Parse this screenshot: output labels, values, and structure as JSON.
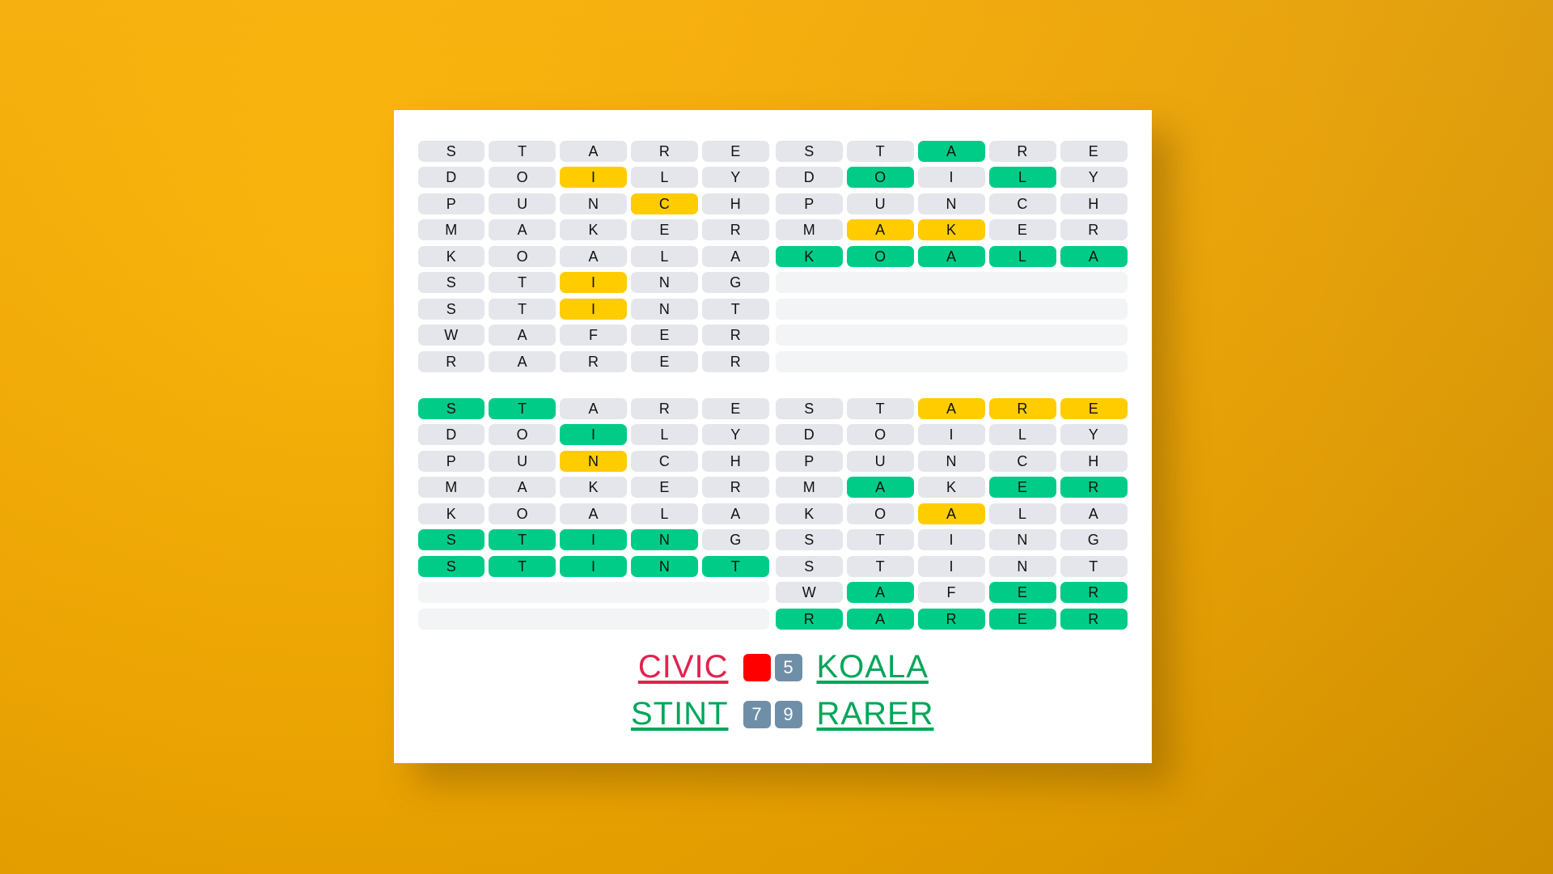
{
  "theme": {
    "background": "#f2a900",
    "card_bg": "#ffffff",
    "tile_empty": "#e4e6eb",
    "tile_blank": "#f3f4f6",
    "tile_green": "#00cc88",
    "tile_yellow": "#ffcc00",
    "word_red": "#e0234e",
    "word_green": "#00a65a",
    "badge_blue": "#6f8fa8",
    "badge_red": "#ff0000"
  },
  "grids": [
    {
      "id": "grid-top-left",
      "rows": [
        {
          "letters": [
            "S",
            "T",
            "A",
            "R",
            "E"
          ],
          "states": [
            "n",
            "n",
            "n",
            "n",
            "n"
          ]
        },
        {
          "letters": [
            "D",
            "O",
            "I",
            "L",
            "Y"
          ],
          "states": [
            "n",
            "n",
            "y",
            "n",
            "n"
          ]
        },
        {
          "letters": [
            "P",
            "U",
            "N",
            "C",
            "H"
          ],
          "states": [
            "n",
            "n",
            "n",
            "y",
            "n"
          ]
        },
        {
          "letters": [
            "M",
            "A",
            "K",
            "E",
            "R"
          ],
          "states": [
            "n",
            "n",
            "n",
            "n",
            "n"
          ]
        },
        {
          "letters": [
            "K",
            "O",
            "A",
            "L",
            "A"
          ],
          "states": [
            "n",
            "n",
            "n",
            "n",
            "n"
          ]
        },
        {
          "letters": [
            "S",
            "T",
            "I",
            "N",
            "G"
          ],
          "states": [
            "n",
            "n",
            "y",
            "n",
            "n"
          ]
        },
        {
          "letters": [
            "S",
            "T",
            "I",
            "N",
            "T"
          ],
          "states": [
            "n",
            "n",
            "y",
            "n",
            "n"
          ]
        },
        {
          "letters": [
            "W",
            "A",
            "F",
            "E",
            "R"
          ],
          "states": [
            "n",
            "n",
            "n",
            "n",
            "n"
          ]
        },
        {
          "letters": [
            "R",
            "A",
            "R",
            "E",
            "R"
          ],
          "states": [
            "n",
            "n",
            "n",
            "n",
            "n"
          ]
        }
      ]
    },
    {
      "id": "grid-top-right",
      "rows": [
        {
          "letters": [
            "S",
            "T",
            "A",
            "R",
            "E"
          ],
          "states": [
            "n",
            "n",
            "g",
            "n",
            "n"
          ]
        },
        {
          "letters": [
            "D",
            "O",
            "I",
            "L",
            "Y"
          ],
          "states": [
            "n",
            "g",
            "n",
            "g",
            "n"
          ]
        },
        {
          "letters": [
            "P",
            "U",
            "N",
            "C",
            "H"
          ],
          "states": [
            "n",
            "n",
            "n",
            "n",
            "n"
          ]
        },
        {
          "letters": [
            "M",
            "A",
            "K",
            "E",
            "R"
          ],
          "states": [
            "n",
            "y",
            "y",
            "n",
            "n"
          ]
        },
        {
          "letters": [
            "K",
            "O",
            "A",
            "L",
            "A"
          ],
          "states": [
            "g",
            "g",
            "g",
            "g",
            "g"
          ]
        },
        {
          "letters": [
            "",
            "",
            "",
            "",
            ""
          ],
          "states": [
            "b",
            "b",
            "b",
            "b",
            "b"
          ]
        },
        {
          "letters": [
            "",
            "",
            "",
            "",
            ""
          ],
          "states": [
            "b",
            "b",
            "b",
            "b",
            "b"
          ]
        },
        {
          "letters": [
            "",
            "",
            "",
            "",
            ""
          ],
          "states": [
            "b",
            "b",
            "b",
            "b",
            "b"
          ]
        },
        {
          "letters": [
            "",
            "",
            "",
            "",
            ""
          ],
          "states": [
            "b",
            "b",
            "b",
            "b",
            "b"
          ]
        }
      ]
    },
    {
      "id": "grid-bottom-left",
      "rows": [
        {
          "letters": [
            "S",
            "T",
            "A",
            "R",
            "E"
          ],
          "states": [
            "g",
            "g",
            "n",
            "n",
            "n"
          ]
        },
        {
          "letters": [
            "D",
            "O",
            "I",
            "L",
            "Y"
          ],
          "states": [
            "n",
            "n",
            "g",
            "n",
            "n"
          ]
        },
        {
          "letters": [
            "P",
            "U",
            "N",
            "C",
            "H"
          ],
          "states": [
            "n",
            "n",
            "y",
            "n",
            "n"
          ]
        },
        {
          "letters": [
            "M",
            "A",
            "K",
            "E",
            "R"
          ],
          "states": [
            "n",
            "n",
            "n",
            "n",
            "n"
          ]
        },
        {
          "letters": [
            "K",
            "O",
            "A",
            "L",
            "A"
          ],
          "states": [
            "n",
            "n",
            "n",
            "n",
            "n"
          ]
        },
        {
          "letters": [
            "S",
            "T",
            "I",
            "N",
            "G"
          ],
          "states": [
            "g",
            "g",
            "g",
            "g",
            "n"
          ]
        },
        {
          "letters": [
            "S",
            "T",
            "I",
            "N",
            "T"
          ],
          "states": [
            "g",
            "g",
            "g",
            "g",
            "g"
          ]
        },
        {
          "letters": [
            "",
            "",
            "",
            "",
            ""
          ],
          "states": [
            "b",
            "b",
            "b",
            "b",
            "b"
          ]
        },
        {
          "letters": [
            "",
            "",
            "",
            "",
            ""
          ],
          "states": [
            "b",
            "b",
            "b",
            "b",
            "b"
          ]
        }
      ]
    },
    {
      "id": "grid-bottom-right",
      "rows": [
        {
          "letters": [
            "S",
            "T",
            "A",
            "R",
            "E"
          ],
          "states": [
            "n",
            "n",
            "y",
            "y",
            "y"
          ]
        },
        {
          "letters": [
            "D",
            "O",
            "I",
            "L",
            "Y"
          ],
          "states": [
            "n",
            "n",
            "n",
            "n",
            "n"
          ]
        },
        {
          "letters": [
            "P",
            "U",
            "N",
            "C",
            "H"
          ],
          "states": [
            "n",
            "n",
            "n",
            "n",
            "n"
          ]
        },
        {
          "letters": [
            "M",
            "A",
            "K",
            "E",
            "R"
          ],
          "states": [
            "n",
            "g",
            "n",
            "g",
            "g"
          ]
        },
        {
          "letters": [
            "K",
            "O",
            "A",
            "L",
            "A"
          ],
          "states": [
            "n",
            "n",
            "y",
            "n",
            "n"
          ]
        },
        {
          "letters": [
            "S",
            "T",
            "I",
            "N",
            "G"
          ],
          "states": [
            "n",
            "n",
            "n",
            "n",
            "n"
          ]
        },
        {
          "letters": [
            "S",
            "T",
            "I",
            "N",
            "T"
          ],
          "states": [
            "n",
            "n",
            "n",
            "n",
            "n"
          ]
        },
        {
          "letters": [
            "W",
            "A",
            "F",
            "E",
            "R"
          ],
          "states": [
            "n",
            "g",
            "n",
            "g",
            "g"
          ]
        },
        {
          "letters": [
            "R",
            "A",
            "R",
            "E",
            "R"
          ],
          "states": [
            "g",
            "g",
            "g",
            "g",
            "g"
          ]
        }
      ]
    }
  ],
  "answers": {
    "row1": {
      "left_word": "CIVIC",
      "left_color": "red",
      "left_badge": "fail",
      "left_badge_text": "",
      "right_badge": "5",
      "right_word": "KOALA",
      "right_color": "green"
    },
    "row2": {
      "left_word": "STINT",
      "left_color": "green",
      "left_badge": "num",
      "left_badge_text": "7",
      "right_badge": "9",
      "right_word": "RARER",
      "right_color": "green"
    }
  }
}
